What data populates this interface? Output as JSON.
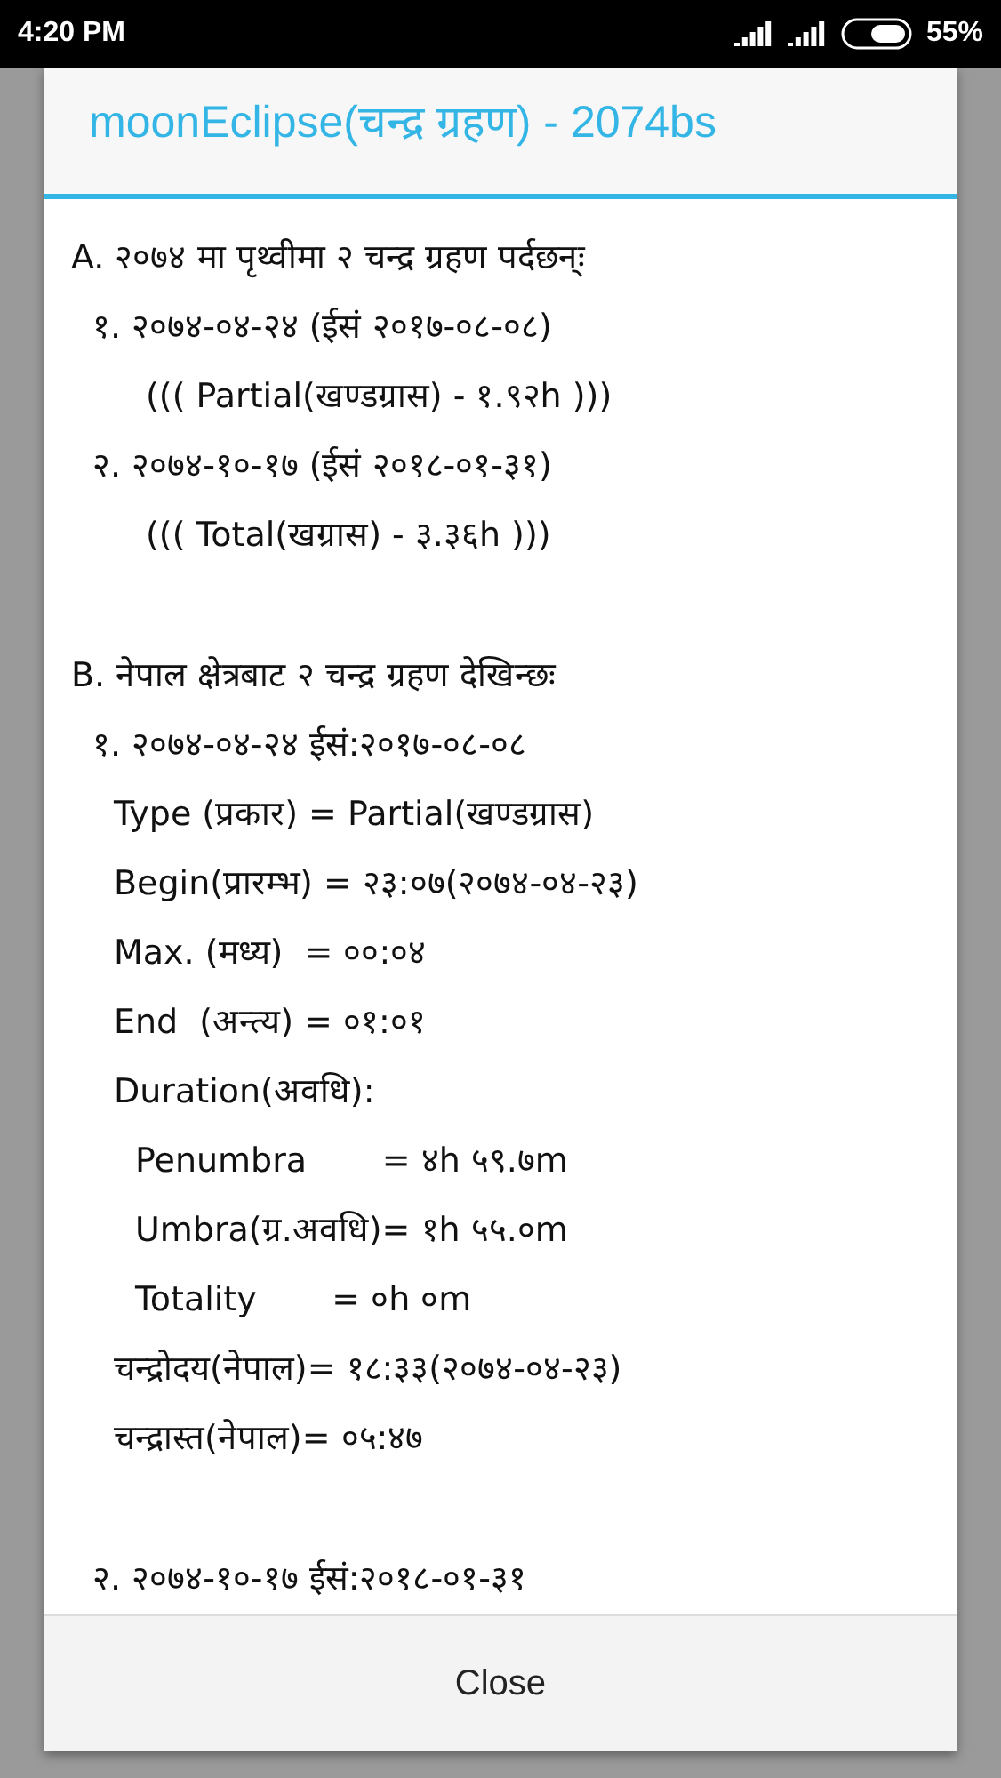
{
  "status_bar": {
    "time": "4:20 PM",
    "battery": "55%"
  },
  "dialog": {
    "title": "moonEclipse(चन्द्र ग्रहण) - 2074bs",
    "blocks": [
      {
        "lines": [
          {
            "kind": "section",
            "text": "A. २०७४ मा पृथ्वीमा २ चन्द्र ग्रहण पर्दछन्ः"
          },
          {
            "kind": "entry",
            "text": "१. २०७४-०४-२४ (ईसं २०१७-०८-०८)"
          },
          {
            "kind": "note",
            "text": "((( Partial(खण्डग्रास) - १.९२h )))"
          },
          {
            "kind": "entry",
            "text": "२. २०७४-१०-१७ (ईसं २०१८-०१-३१)"
          },
          {
            "kind": "note",
            "text": "((( Total(खग्रास) - ३.३६h )))"
          }
        ]
      },
      {
        "lines": [
          {
            "kind": "section",
            "text": "B. नेपाल क्षेत्रबाट २ चन्द्र ग्रहण देखिन्छः"
          },
          {
            "kind": "entry",
            "text": "१. २०७४-०४-२४ ईसं:२०१७-०८-०८"
          },
          {
            "kind": "field",
            "text": "Type (प्रकार) = Partial(खण्डग्रास)"
          },
          {
            "kind": "field",
            "text": "Begin(प्रारम्भ) = २३:०७(२०७४-०४-२३)"
          },
          {
            "kind": "field",
            "text": "Max. (मध्य)  = ००:०४"
          },
          {
            "kind": "field",
            "text": "End  (अन्त्य) = ०१:०१"
          },
          {
            "kind": "field",
            "text": "Duration(अवधि):"
          },
          {
            "kind": "subfield",
            "text": "Penumbra       = ४h ५९.७m"
          },
          {
            "kind": "subfield",
            "text": "Umbra(ग्र.अवधि)= १h ५५.०m"
          },
          {
            "kind": "subfield",
            "text": "Totality       = ०h ०m"
          },
          {
            "kind": "field",
            "text": "चन्द्रोदय(नेपाल)= १८:३३(२०७४-०४-२३)"
          },
          {
            "kind": "field",
            "text": "चन्द्रास्त(नेपाल)= ०५:४७"
          }
        ]
      },
      {
        "lines": [
          {
            "kind": "entry",
            "text": "२. २०७४-१०-१७ ईसं:२०१८-०१-३१"
          }
        ]
      }
    ],
    "button": "Close"
  }
}
